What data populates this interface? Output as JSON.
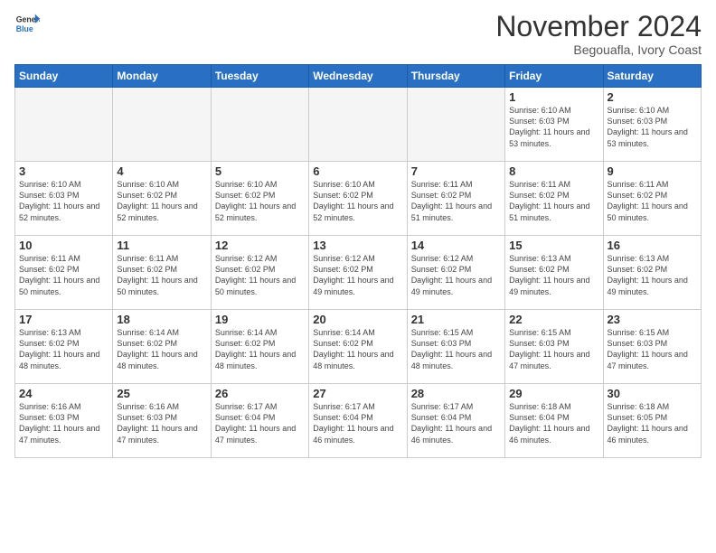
{
  "header": {
    "logo": {
      "line1": "General",
      "line2": "Blue"
    },
    "title": "November 2024",
    "location": "Begouafla, Ivory Coast"
  },
  "weekdays": [
    "Sunday",
    "Monday",
    "Tuesday",
    "Wednesday",
    "Thursday",
    "Friday",
    "Saturday"
  ],
  "weeks": [
    [
      {
        "day": "",
        "empty": true
      },
      {
        "day": "",
        "empty": true
      },
      {
        "day": "",
        "empty": true
      },
      {
        "day": "",
        "empty": true
      },
      {
        "day": "",
        "empty": true
      },
      {
        "day": "1",
        "sunrise": "Sunrise: 6:10 AM",
        "sunset": "Sunset: 6:03 PM",
        "daylight": "Daylight: 11 hours and 53 minutes."
      },
      {
        "day": "2",
        "sunrise": "Sunrise: 6:10 AM",
        "sunset": "Sunset: 6:03 PM",
        "daylight": "Daylight: 11 hours and 53 minutes."
      }
    ],
    [
      {
        "day": "3",
        "sunrise": "Sunrise: 6:10 AM",
        "sunset": "Sunset: 6:03 PM",
        "daylight": "Daylight: 11 hours and 52 minutes."
      },
      {
        "day": "4",
        "sunrise": "Sunrise: 6:10 AM",
        "sunset": "Sunset: 6:02 PM",
        "daylight": "Daylight: 11 hours and 52 minutes."
      },
      {
        "day": "5",
        "sunrise": "Sunrise: 6:10 AM",
        "sunset": "Sunset: 6:02 PM",
        "daylight": "Daylight: 11 hours and 52 minutes."
      },
      {
        "day": "6",
        "sunrise": "Sunrise: 6:10 AM",
        "sunset": "Sunset: 6:02 PM",
        "daylight": "Daylight: 11 hours and 52 minutes."
      },
      {
        "day": "7",
        "sunrise": "Sunrise: 6:11 AM",
        "sunset": "Sunset: 6:02 PM",
        "daylight": "Daylight: 11 hours and 51 minutes."
      },
      {
        "day": "8",
        "sunrise": "Sunrise: 6:11 AM",
        "sunset": "Sunset: 6:02 PM",
        "daylight": "Daylight: 11 hours and 51 minutes."
      },
      {
        "day": "9",
        "sunrise": "Sunrise: 6:11 AM",
        "sunset": "Sunset: 6:02 PM",
        "daylight": "Daylight: 11 hours and 50 minutes."
      }
    ],
    [
      {
        "day": "10",
        "sunrise": "Sunrise: 6:11 AM",
        "sunset": "Sunset: 6:02 PM",
        "daylight": "Daylight: 11 hours and 50 minutes."
      },
      {
        "day": "11",
        "sunrise": "Sunrise: 6:11 AM",
        "sunset": "Sunset: 6:02 PM",
        "daylight": "Daylight: 11 hours and 50 minutes."
      },
      {
        "day": "12",
        "sunrise": "Sunrise: 6:12 AM",
        "sunset": "Sunset: 6:02 PM",
        "daylight": "Daylight: 11 hours and 50 minutes."
      },
      {
        "day": "13",
        "sunrise": "Sunrise: 6:12 AM",
        "sunset": "Sunset: 6:02 PM",
        "daylight": "Daylight: 11 hours and 49 minutes."
      },
      {
        "day": "14",
        "sunrise": "Sunrise: 6:12 AM",
        "sunset": "Sunset: 6:02 PM",
        "daylight": "Daylight: 11 hours and 49 minutes."
      },
      {
        "day": "15",
        "sunrise": "Sunrise: 6:13 AM",
        "sunset": "Sunset: 6:02 PM",
        "daylight": "Daylight: 11 hours and 49 minutes."
      },
      {
        "day": "16",
        "sunrise": "Sunrise: 6:13 AM",
        "sunset": "Sunset: 6:02 PM",
        "daylight": "Daylight: 11 hours and 49 minutes."
      }
    ],
    [
      {
        "day": "17",
        "sunrise": "Sunrise: 6:13 AM",
        "sunset": "Sunset: 6:02 PM",
        "daylight": "Daylight: 11 hours and 48 minutes."
      },
      {
        "day": "18",
        "sunrise": "Sunrise: 6:14 AM",
        "sunset": "Sunset: 6:02 PM",
        "daylight": "Daylight: 11 hours and 48 minutes."
      },
      {
        "day": "19",
        "sunrise": "Sunrise: 6:14 AM",
        "sunset": "Sunset: 6:02 PM",
        "daylight": "Daylight: 11 hours and 48 minutes."
      },
      {
        "day": "20",
        "sunrise": "Sunrise: 6:14 AM",
        "sunset": "Sunset: 6:02 PM",
        "daylight": "Daylight: 11 hours and 48 minutes."
      },
      {
        "day": "21",
        "sunrise": "Sunrise: 6:15 AM",
        "sunset": "Sunset: 6:03 PM",
        "daylight": "Daylight: 11 hours and 48 minutes."
      },
      {
        "day": "22",
        "sunrise": "Sunrise: 6:15 AM",
        "sunset": "Sunset: 6:03 PM",
        "daylight": "Daylight: 11 hours and 47 minutes."
      },
      {
        "day": "23",
        "sunrise": "Sunrise: 6:15 AM",
        "sunset": "Sunset: 6:03 PM",
        "daylight": "Daylight: 11 hours and 47 minutes."
      }
    ],
    [
      {
        "day": "24",
        "sunrise": "Sunrise: 6:16 AM",
        "sunset": "Sunset: 6:03 PM",
        "daylight": "Daylight: 11 hours and 47 minutes."
      },
      {
        "day": "25",
        "sunrise": "Sunrise: 6:16 AM",
        "sunset": "Sunset: 6:03 PM",
        "daylight": "Daylight: 11 hours and 47 minutes."
      },
      {
        "day": "26",
        "sunrise": "Sunrise: 6:17 AM",
        "sunset": "Sunset: 6:04 PM",
        "daylight": "Daylight: 11 hours and 47 minutes."
      },
      {
        "day": "27",
        "sunrise": "Sunrise: 6:17 AM",
        "sunset": "Sunset: 6:04 PM",
        "daylight": "Daylight: 11 hours and 46 minutes."
      },
      {
        "day": "28",
        "sunrise": "Sunrise: 6:17 AM",
        "sunset": "Sunset: 6:04 PM",
        "daylight": "Daylight: 11 hours and 46 minutes."
      },
      {
        "day": "29",
        "sunrise": "Sunrise: 6:18 AM",
        "sunset": "Sunset: 6:04 PM",
        "daylight": "Daylight: 11 hours and 46 minutes."
      },
      {
        "day": "30",
        "sunrise": "Sunrise: 6:18 AM",
        "sunset": "Sunset: 6:05 PM",
        "daylight": "Daylight: 11 hours and 46 minutes."
      }
    ]
  ]
}
